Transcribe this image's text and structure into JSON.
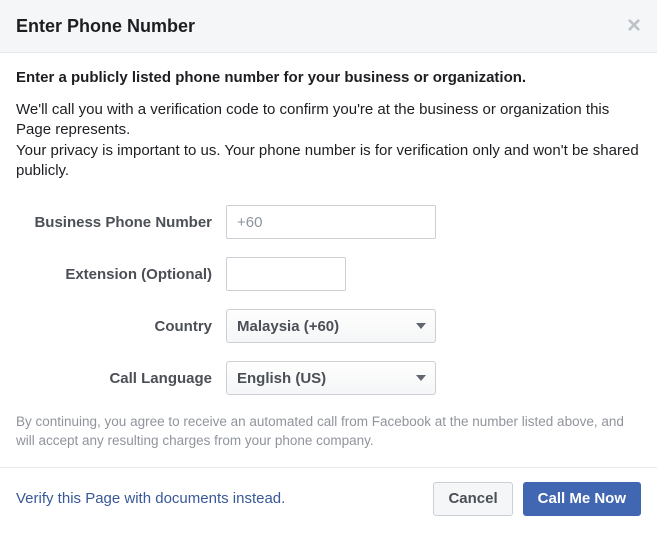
{
  "header": {
    "title": "Enter Phone Number"
  },
  "intro": {
    "bold": "Enter a publicly listed phone number for your business or organization.",
    "line1": "We'll call you with a verification code to confirm you're at the business or organization this Page represents.",
    "line2": "Your privacy is important to us. Your phone number is for verification only and won't be shared publicly."
  },
  "form": {
    "phone_label": "Business Phone Number",
    "phone_placeholder": "+60",
    "ext_label": "Extension (Optional)",
    "country_label": "Country",
    "country_value": "Malaysia (+60)",
    "language_label": "Call Language",
    "language_value": "English (US)"
  },
  "disclaimer": "By continuing, you agree to receive an automated call from Facebook at the number listed above, and will accept any resulting charges from your phone company.",
  "footer": {
    "alt_link": "Verify this Page with documents instead.",
    "cancel": "Cancel",
    "submit": "Call Me Now"
  }
}
